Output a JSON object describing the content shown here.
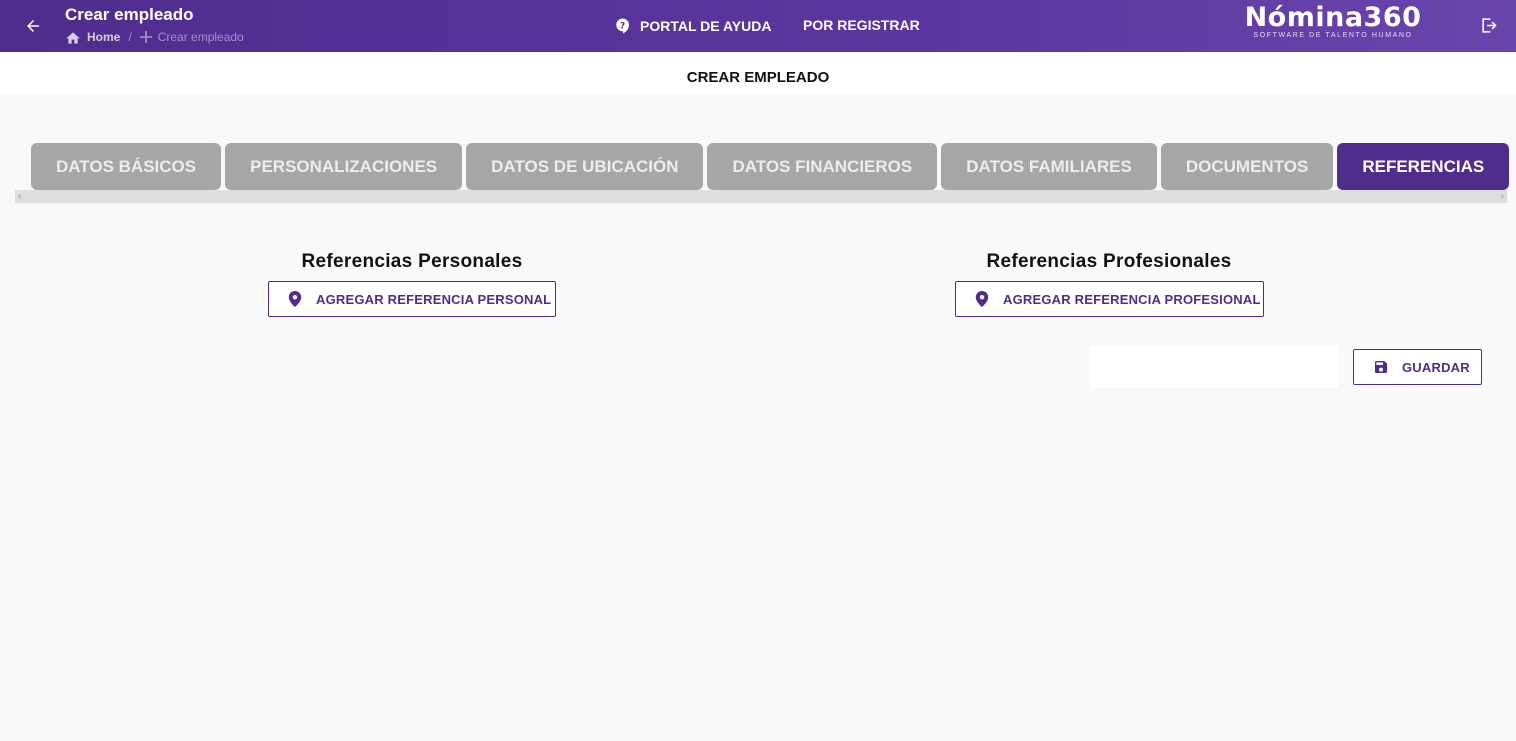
{
  "header": {
    "title": "Crear empleado",
    "breadcrumb": {
      "home": "Home",
      "separator": "/",
      "current": "Crear empleado"
    },
    "nav": {
      "help": "PORTAL DE AYUDA",
      "register": "POR REGISTRAR"
    },
    "logo": {
      "main": "Nómina360",
      "tagline": "SOFTWARE DE TALENTO HUMANO"
    },
    "icons": [
      "arrow-left-icon",
      "home-icon",
      "plus-icon",
      "help-icon",
      "logout-icon"
    ]
  },
  "page": {
    "title": "CREAR EMPLEADO"
  },
  "tabs": [
    {
      "label": "DATOS BÁSICOS",
      "active": false
    },
    {
      "label": "PERSONALIZACIONES",
      "active": false
    },
    {
      "label": "DATOS DE UBICACIÓN",
      "active": false
    },
    {
      "label": "DATOS FINANCIEROS",
      "active": false
    },
    {
      "label": "DATOS FAMILIARES",
      "active": false
    },
    {
      "label": "DOCUMENTOS",
      "active": false
    },
    {
      "label": "REFERENCIAS",
      "active": true
    }
  ],
  "sections": {
    "personal": {
      "title": "Referencias Personales",
      "button": "AGREGAR REFERENCIA PERSONAL"
    },
    "professional": {
      "title": "Referencias Profesionales",
      "button": "AGREGAR REFERENCIA PROFESIONAL"
    }
  },
  "actions": {
    "save": "GUARDAR"
  },
  "colors": {
    "brand": "#4f2d8c",
    "tab_inactive": "#a6a6a6",
    "background": "#f9f9f9"
  }
}
